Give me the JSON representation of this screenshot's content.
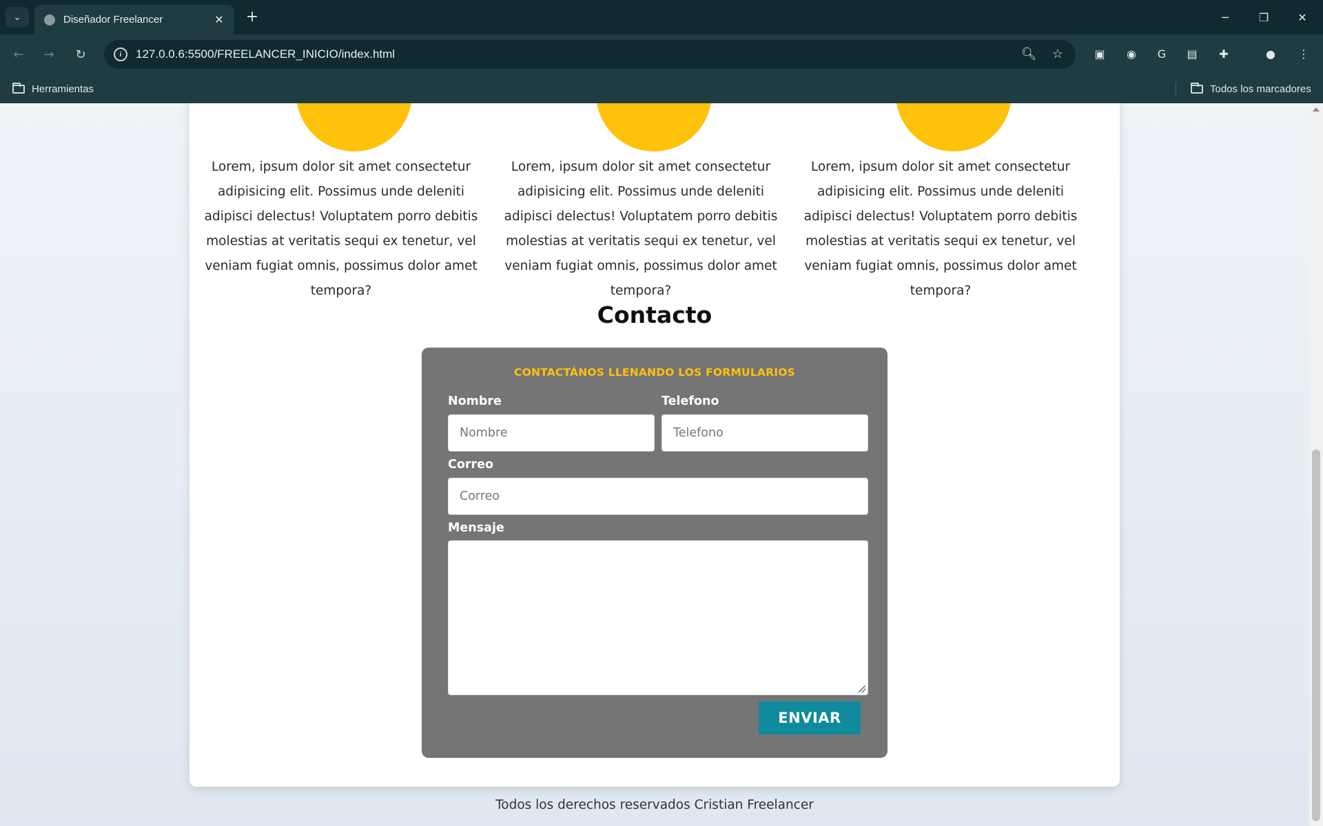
{
  "browser": {
    "tab_title": "Diseñador Freelancer",
    "url": "127.0.0.6:5500/FREELANCER_INICIO/index.html",
    "bookmarks": {
      "left": "Herramientas",
      "right": "Todos los marcadores"
    }
  },
  "page": {
    "features": [
      {
        "text": "Lorem, ipsum dolor sit amet consectetur adipisicing elit. Possimus unde deleniti adipisci delectus! Voluptatem porro debitis molestias at veritatis sequi ex tenetur, vel veniam fugiat omnis, possimus dolor amet tempora?"
      },
      {
        "text": "Lorem, ipsum dolor sit amet consectetur adipisicing elit. Possimus unde deleniti adipisci delectus! Voluptatem porro debitis molestias at veritatis sequi ex tenetur, vel veniam fugiat omnis, possimus dolor amet tempora?"
      },
      {
        "text": "Lorem, ipsum dolor sit amet consectetur adipisicing elit. Possimus unde deleniti adipisci delectus! Voluptatem porro debitis molestias at veritatis sequi ex tenetur, vel veniam fugiat omnis, possimus dolor amet tempora?"
      }
    ],
    "contact": {
      "heading": "Contacto",
      "form_title": "CONTACTÁNOS LLENANDO LOS FORMULARIOS",
      "name_label": "Nombre",
      "name_placeholder": "Nombre",
      "phone_label": "Telefono",
      "phone_placeholder": "Telefono",
      "email_label": "Correo",
      "email_placeholder": "Correo",
      "message_label": "Mensaje",
      "submit_label": "ENVIAR"
    },
    "footer": "Todos los derechos reservados Cristian Freelancer"
  },
  "colors": {
    "accent_yellow": "#ffc20a",
    "form_background": "#757575",
    "button_teal": "#0e8a9c"
  }
}
